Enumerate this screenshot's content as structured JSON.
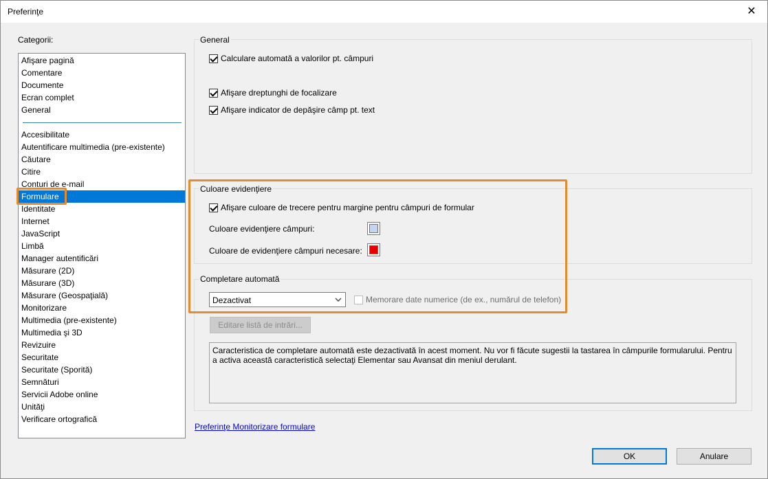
{
  "window": {
    "title": "Preferinţe",
    "close_glyph": "✕"
  },
  "categories": {
    "label": "Categorii:",
    "top_items": [
      "Afişare pagină",
      "Comentare",
      "Documente",
      "Ecran complet",
      "General"
    ],
    "items": [
      "Accesibilitate",
      "Autentificare multimedia (pre-existente)",
      "Căutare",
      "Citire",
      "Conturi de e-mail",
      "Formulare",
      "Identitate",
      "Internet",
      "JavaScript",
      "Limbă",
      "Manager autentificări",
      "Măsurare (2D)",
      "Măsurare (3D)",
      "Măsurare (Geospaţială)",
      "Monitorizare",
      "Multimedia (pre-existente)",
      "Multimedia şi 3D",
      "Revizuire",
      "Securitate",
      "Securitate (Sporită)",
      "Semnături",
      "Servicii Adobe online",
      "Unităţi",
      "Verificare ortografică"
    ],
    "selected": "Formulare"
  },
  "general": {
    "title": "General",
    "auto_calc": {
      "label": "Calculare automată a valorilor pt. câmpuri",
      "checked": true
    },
    "focus_rect": {
      "label": "Afişare dreptunghi de focalizare",
      "checked": true
    },
    "overflow_indicator": {
      "label": "Afişare indicator de depăşire câmp pt. text",
      "checked": true
    }
  },
  "highlight": {
    "title": "Culoare evidenţiere",
    "hover_border": {
      "label": "Afişare culoare de trecere pentru margine pentru câmpuri de formular",
      "checked": true
    },
    "field_color_label": "Culoare evidenţiere câmpuri:",
    "field_color": "#c5d3f7",
    "required_color_label": "Culoare de evidenţiere câmpuri necesare:",
    "required_color": "#e60000"
  },
  "autocomplete": {
    "title": "Completare automată",
    "mode": "Dezactivat",
    "dropdown_icon": "chevron-down-icon",
    "remember_numeric": {
      "label": "Memorare date numerice (de ex., numărul de telefon)",
      "checked": false,
      "enabled": false
    },
    "edit_list_label": "Editare listă de intrări...",
    "description": "Caracteristica de completare automată este dezactivată în acest moment. Nu vor fi făcute sugestii la tastarea în câmpurile formularului. Pentru a activa această caracteristică selectaţi Elementar sau Avansat din meniul derulant."
  },
  "footer": {
    "link_label": "Preferinţe Monitorizare formulare",
    "ok_label": "OK",
    "cancel_label": "Anulare"
  },
  "colors": {
    "accent": "#0078d7",
    "annotation_orange": "#e68a2e"
  }
}
